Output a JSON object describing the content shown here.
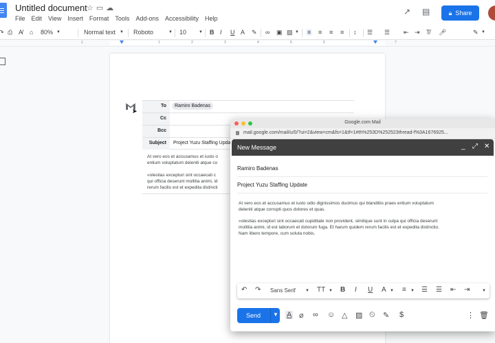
{
  "docs": {
    "title": "Untitled document",
    "menu": [
      "File",
      "Edit",
      "View",
      "Insert",
      "Format",
      "Tools",
      "Add-ons",
      "Accessibility",
      "Help"
    ],
    "share_label": "Share",
    "toolbar": {
      "zoom": "80%",
      "style": "Normal text",
      "font": "Roboto",
      "size": "10"
    },
    "ruler_marks": [
      "1",
      "1",
      "2",
      "3",
      "4",
      "5",
      "6",
      "7"
    ]
  },
  "mail_merge_table": {
    "to_label": "To",
    "to_value": "Ramiro Badenas",
    "cc_label": "Cc",
    "bcc_label": "Bcc",
    "subject_label": "Subject",
    "subject_value": "Project Yuzu Staffing Upda",
    "body_line1": "At vero eos et accusamus et iusto o",
    "body_line2": "entium voluptatum deleniti atque co",
    "body_line3": "«olestias excepturi sint occaecati c",
    "body_line4": "qui officia deserunt mollitia animi, id",
    "body_line5": "rerum facilis est et expedita distincti"
  },
  "browser": {
    "window_title": "Google.com Mail",
    "url": "mail.google.com/mail/u/0/?ui=2&view=cm&fs=1&tf=1#th%253D%252523thread-f%3A1676925..."
  },
  "compose": {
    "header_title": "New Message",
    "to": "Ramiro Badenas",
    "subject": "Project Yuzu Staffing Update",
    "body_p1_line1": "At vero eos et accusamus et iusto odio dignissimos ducimus qui blanditiis praes entium voluptatum",
    "body_p1_line2": "deleniti atque corrupti quos dolores et quas.",
    "body_p2_line1": "«olestias excepturi sint occaecati cupiditate non provident, similique sunt in culpa qui officia deserunt",
    "body_p2_line2": "mollitia animi, id est laborum et dolorum fuga. Et harum quidem rerum facilis est et expedita distinctio.",
    "body_p2_line3": "Nam libero tempore, cum soluta nobis.",
    "font_select": "Sans Serif",
    "send_label": "Send"
  }
}
